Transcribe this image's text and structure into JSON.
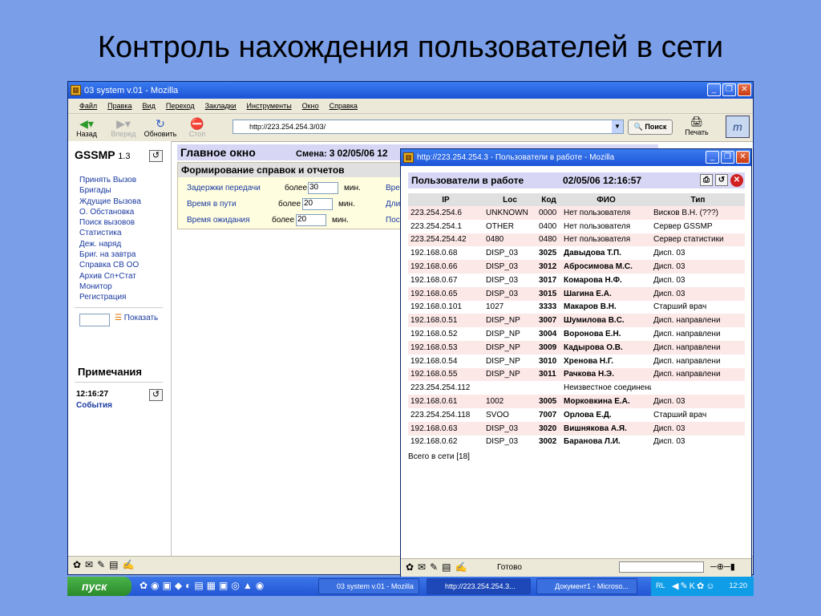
{
  "slide": {
    "title": "Контроль нахождения пользователей в сети"
  },
  "main_window": {
    "title": "03 system v.01 - Mozilla",
    "menu": [
      "Файл",
      "Правка",
      "Вид",
      "Переход",
      "Закладки",
      "Инструменты",
      "Окно",
      "Справка"
    ],
    "nav": {
      "back": "Назад",
      "forward": "Вперед",
      "reload": "Обновить",
      "stop": "Стоп",
      "search": "Поиск",
      "print": "Печать"
    },
    "url": "http://223.254.254.3/03/",
    "sidebar": {
      "app_name": "GSSMP",
      "version": "1.3",
      "items": [
        "Принять Вызов",
        "Бригады",
        "Ждущие Вызова",
        "О. Обстановка",
        "Поиск вызовов",
        "Статистика",
        "Деж. наряд",
        "Бриг. на завтра",
        "Справка СВ ОО",
        "Архив Сп+Стат",
        "Монитор",
        "Регистрация"
      ],
      "show_label": "Показать",
      "notes_title": "Примечания",
      "time": "12:16:27",
      "events": "События"
    },
    "header": {
      "title": "Главное окно",
      "shift_label": "Смена:",
      "shift_value": "3",
      "date": "02/05/06",
      "cut": "12"
    },
    "reports": {
      "title": "Формирование справок и отчетов",
      "rows": [
        {
          "label": "Задержки передачи",
          "more": "более",
          "value": "30",
          "unit": "мин.",
          "cut": "Вре"
        },
        {
          "label": "Время в пути",
          "more": "более",
          "value": "20",
          "unit": "мин.",
          "cut": "Дли"
        },
        {
          "label": "Время ожидания",
          "more": "более",
          "value": "20",
          "unit": "мин.",
          "cut": "Пос"
        }
      ]
    }
  },
  "popup": {
    "title": "http://223.254.254.3 - Пользователи в работе - Mozilla",
    "header": "Пользователи в работе",
    "datetime": "02/05/06   12:16:57",
    "columns": [
      "IP",
      "Loc",
      "Код",
      "ФИО",
      "Тип"
    ],
    "rows": [
      [
        "223.254.254.6",
        "UNKNOWN",
        "0000",
        "Нет пользователя",
        "Висков В.Н. (???)"
      ],
      [
        "223.254.254.1",
        "OTHER",
        "0400",
        "Нет пользователя",
        "Сервер GSSMP"
      ],
      [
        "223.254.254.42",
        "0480",
        "0480",
        "Нет пользователя",
        "Сервер статистики"
      ],
      [
        "192.168.0.68",
        "DISP_03",
        "3025",
        "Давыдова Т.П.",
        "Дисп. 03"
      ],
      [
        "192.168.0.66",
        "DISP_03",
        "3012",
        "Абросимова М.С.",
        "Дисп. 03"
      ],
      [
        "192.168.0.67",
        "DISP_03",
        "3017",
        "Комарова Н.Ф.",
        "Дисп. 03"
      ],
      [
        "192.168.0.65",
        "DISP_03",
        "3015",
        "Шагина Е.А.",
        "Дисп. 03"
      ],
      [
        "192.168.0.101",
        "1027",
        "3333",
        "Макаров В.Н.",
        "Старший врач"
      ],
      [
        "192.168.0.51",
        "DISP_NP",
        "3007",
        "Шумилова В.С.",
        "Дисп. направлени"
      ],
      [
        "192.168.0.52",
        "DISP_NP",
        "3004",
        "Воронова Е.Н.",
        "Дисп. направлени"
      ],
      [
        "192.168.0.53",
        "DISP_NP",
        "3009",
        "Кадырова О.В.",
        "Дисп. направлени"
      ],
      [
        "192.168.0.54",
        "DISP_NP",
        "3010",
        "Хренова Н.Г.",
        "Дисп. направлени"
      ],
      [
        "192.168.0.55",
        "DISP_NP",
        "3011",
        "Рачкова Н.Э.",
        "Дисп. направлени"
      ],
      [
        "223.254.254.112",
        "",
        "",
        "Неизвестное соединение",
        ""
      ],
      [
        "192.168.0.61",
        "1002",
        "3005",
        "Морковкина Е.А.",
        "Дисп. 03"
      ],
      [
        "223.254.254.118",
        "SVOO",
        "7007",
        "Орлова Е.Д.",
        "Старший врач"
      ],
      [
        "192.168.0.63",
        "DISP_03",
        "3020",
        "Вишнякова А.Я.",
        "Дисп. 03"
      ],
      [
        "192.168.0.62",
        "DISP_03",
        "3002",
        "Баранова Л.И.",
        "Дисп. 03"
      ]
    ],
    "total": "Всего в сети [18]",
    "status": "Готово"
  },
  "taskbar": {
    "start": "пуск",
    "tasks": [
      "03 system v.01 - Mozilla",
      "http://223.254.254.3...",
      "Документ1 - Microso..."
    ],
    "lang": "RL",
    "clock": "12:20"
  }
}
